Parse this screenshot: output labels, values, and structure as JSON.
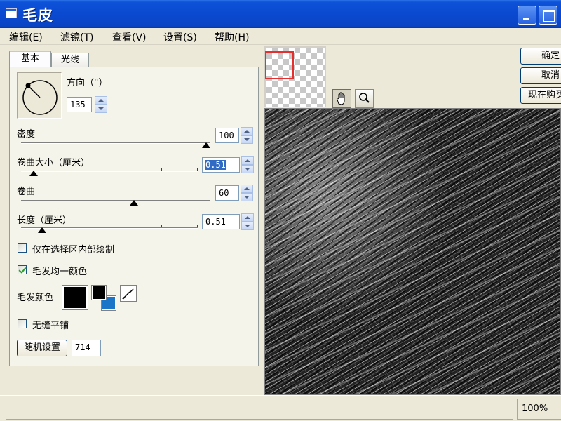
{
  "window": {
    "title": "毛皮"
  },
  "menu": [
    "编辑(E)",
    "滤镜(T)",
    "查看(V)",
    "设置(S)",
    "帮助(H)"
  ],
  "tabs": {
    "basic": "基本",
    "light": "光线"
  },
  "direction": {
    "label": "方向（°）",
    "value": "135"
  },
  "density": {
    "label": "密度",
    "value": "100",
    "level_percent": 100
  },
  "curl_size": {
    "label": "卷曲大小（厘米）",
    "value": "0.51",
    "level_percent": 5
  },
  "curl": {
    "label": "卷曲",
    "value": "60",
    "level_percent": 60
  },
  "length": {
    "label": "长度（厘米）",
    "value": "0.51",
    "level_percent": 10
  },
  "checkboxes": {
    "inside_selection": {
      "label": "仅在选择区内部绘制",
      "checked": false
    },
    "uniform_color": {
      "label": "毛发均一颜色",
      "checked": true
    },
    "seamless": {
      "label": "无缝平铺",
      "checked": false
    }
  },
  "hair_color": {
    "label": "毛发颜色",
    "color": "#000000",
    "fg": "#000000",
    "bg": "#1a74c8"
  },
  "random": {
    "button": "随机设置",
    "seed": "714"
  },
  "buttons": {
    "ok": "确定",
    "cancel": "取消",
    "buy": "现在购买"
  },
  "tools": {
    "hand": "hand-icon",
    "zoom": "magnifier-icon"
  },
  "status": {
    "zoom": "100%"
  }
}
